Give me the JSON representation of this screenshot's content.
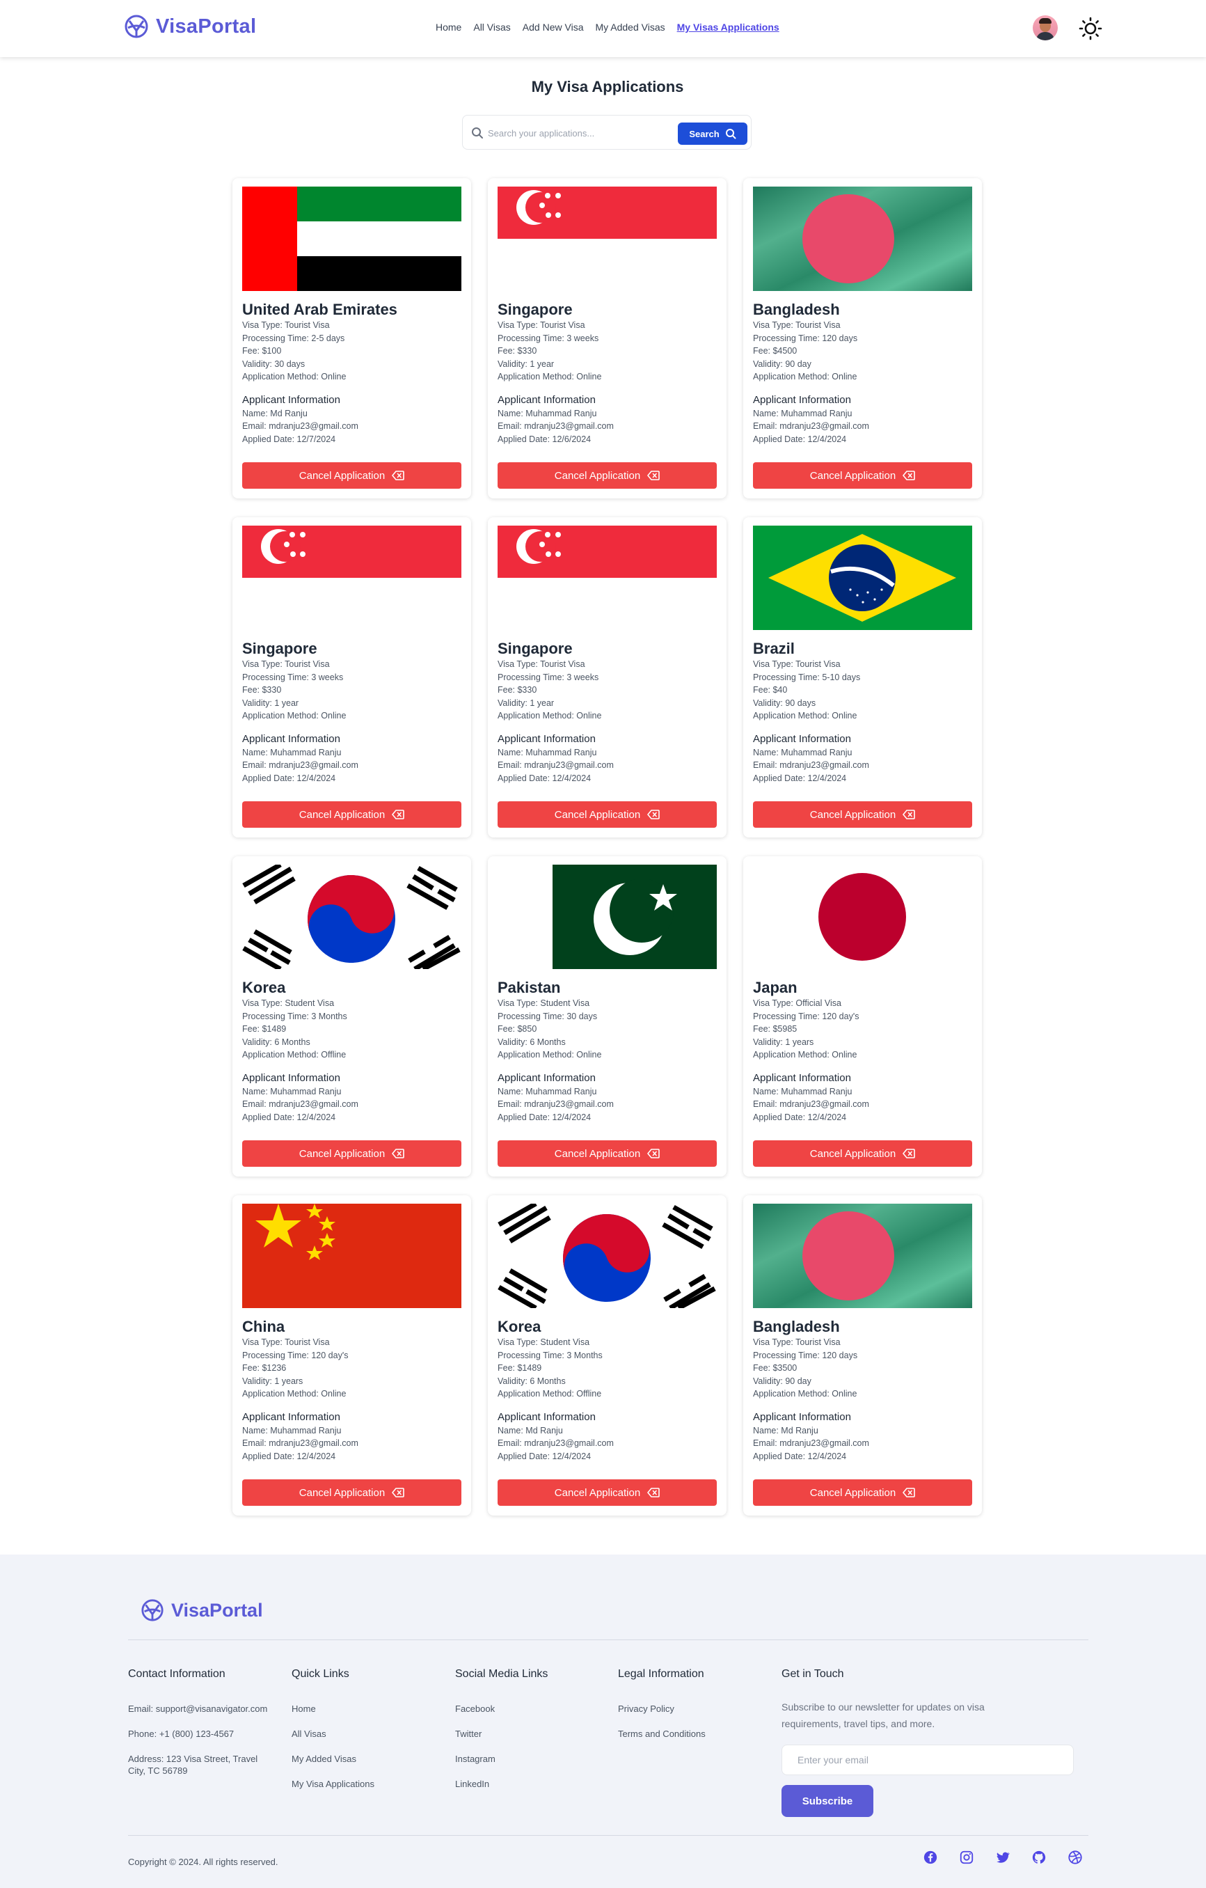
{
  "header": {
    "logo_text": "VisaPortal",
    "nav": [
      "Home",
      "All Visas",
      "Add New Visa",
      "My Added Visas",
      "My Visas Applications"
    ],
    "active_nav_index": 4
  },
  "main": {
    "title": "My Visa Applications",
    "search_placeholder": "Search your applications...",
    "search_button": "Search"
  },
  "labels": {
    "applicant_info": "Applicant Information",
    "cancel": "Cancel Application"
  },
  "applications": [
    {
      "flag": "uae",
      "country": "United Arab Emirates",
      "visa_type": "Visa Type: Tourist Visa",
      "processing": "Processing Time: 2-5 days",
      "fee": "Fee: $100",
      "validity": "Validity: 30 days",
      "method": "Application Method: Online",
      "name": "Name: Md Ranju",
      "email": "Email: mdranju23@gmail.com",
      "date": "Applied Date: 12/7/2024"
    },
    {
      "flag": "singapore",
      "country": "Singapore",
      "visa_type": "Visa Type: Tourist Visa",
      "processing": "Processing Time: 3 weeks",
      "fee": "Fee: $330",
      "validity": "Validity: 1 year",
      "method": "Application Method: Online",
      "name": "Name: Muhammad Ranju",
      "email": "Email: mdranju23@gmail.com",
      "date": "Applied Date: 12/6/2024"
    },
    {
      "flag": "bangladesh",
      "country": "Bangladesh",
      "visa_type": "Visa Type: Tourist Visa",
      "processing": "Processing Time: 120 days",
      "fee": "Fee: $4500",
      "validity": "Validity: 90 day",
      "method": "Application Method: Online",
      "name": "Name: Muhammad Ranju",
      "email": "Email: mdranju23@gmail.com",
      "date": "Applied Date: 12/4/2024"
    },
    {
      "flag": "singapore",
      "country": "Singapore",
      "visa_type": "Visa Type: Tourist Visa",
      "processing": "Processing Time: 3 weeks",
      "fee": "Fee: $330",
      "validity": "Validity: 1 year",
      "method": "Application Method: Online",
      "name": "Name: Muhammad Ranju",
      "email": "Email: mdranju23@gmail.com",
      "date": "Applied Date: 12/4/2024"
    },
    {
      "flag": "singapore",
      "country": "Singapore",
      "visa_type": "Visa Type: Tourist Visa",
      "processing": "Processing Time: 3 weeks",
      "fee": "Fee: $330",
      "validity": "Validity: 1 year",
      "method": "Application Method: Online",
      "name": "Name: Muhammad Ranju",
      "email": "Email: mdranju23@gmail.com",
      "date": "Applied Date: 12/4/2024"
    },
    {
      "flag": "brazil",
      "country": "Brazil",
      "visa_type": "Visa Type: Tourist Visa",
      "processing": "Processing Time: 5-10 days",
      "fee": "Fee: $40",
      "validity": "Validity: 90 days",
      "method": "Application Method: Online",
      "name": "Name: Muhammad Ranju",
      "email": "Email: mdranju23@gmail.com",
      "date": "Applied Date: 12/4/2024"
    },
    {
      "flag": "korea",
      "country": "Korea",
      "visa_type": "Visa Type: Student Visa",
      "processing": "Processing Time: 3 Months",
      "fee": "Fee: $1489",
      "validity": "Validity: 6 Months",
      "method": "Application Method: Offline",
      "name": "Name: Muhammad Ranju",
      "email": "Email: mdranju23@gmail.com",
      "date": "Applied Date: 12/4/2024"
    },
    {
      "flag": "pakistan",
      "country": "Pakistan",
      "visa_type": "Visa Type: Student Visa",
      "processing": "Processing Time: 30 days",
      "fee": "Fee: $850",
      "validity": "Validity: 6 Months",
      "method": "Application Method: Online",
      "name": "Name: Muhammad Ranju",
      "email": "Email: mdranju23@gmail.com",
      "date": "Applied Date: 12/4/2024"
    },
    {
      "flag": "japan",
      "country": "Japan",
      "visa_type": "Visa Type: Official Visa",
      "processing": "Processing Time: 120 day's",
      "fee": "Fee: $5985",
      "validity": "Validity: 1 years",
      "method": "Application Method: Online",
      "name": "Name: Muhammad Ranju",
      "email": "Email: mdranju23@gmail.com",
      "date": "Applied Date: 12/4/2024"
    },
    {
      "flag": "china",
      "country": "China",
      "visa_type": "Visa Type: Tourist Visa",
      "processing": "Processing Time: 120 day's",
      "fee": "Fee: $1236",
      "validity": "Validity: 1 years",
      "method": "Application Method: Online",
      "name": "Name: Muhammad Ranju",
      "email": "Email: mdranju23@gmail.com",
      "date": "Applied Date: 12/4/2024"
    },
    {
      "flag": "korea",
      "country": "Korea",
      "visa_type": "Visa Type: Student Visa",
      "processing": "Processing Time: 3 Months",
      "fee": "Fee: $1489",
      "validity": "Validity: 6 Months",
      "method": "Application Method: Offline",
      "name": "Name: Md Ranju",
      "email": "Email: mdranju23@gmail.com",
      "date": "Applied Date: 12/4/2024"
    },
    {
      "flag": "bangladesh",
      "country": "Bangladesh",
      "visa_type": "Visa Type: Tourist Visa",
      "processing": "Processing Time: 120 days",
      "fee": "Fee: $3500",
      "validity": "Validity: 90 day",
      "method": "Application Method: Online",
      "name": "Name: Md Ranju",
      "email": "Email: mdranju23@gmail.com",
      "date": "Applied Date: 12/4/2024"
    }
  ],
  "footer": {
    "logo_text": "VisaPortal",
    "contact": {
      "title": "Contact Information",
      "email": "Email: support@visanavigator.com",
      "phone": "Phone: +1 (800) 123-4567",
      "address": "Address: 123 Visa Street, Travel City, TC 56789"
    },
    "quick_links": {
      "title": "Quick Links",
      "items": [
        "Home",
        "All Visas",
        "My Added Visas",
        "My Visa Applications"
      ]
    },
    "social": {
      "title": "Social Media Links",
      "items": [
        "Facebook",
        "Twitter",
        "Instagram",
        "LinkedIn"
      ]
    },
    "legal": {
      "title": "Legal Information",
      "items": [
        "Privacy Policy",
        "Terms and Conditions"
      ]
    },
    "newsletter": {
      "title": "Get in Touch",
      "text": "Subscribe to our newsletter for updates on visa requirements, travel tips, and more.",
      "placeholder": "Enter your email",
      "button": "Subscribe"
    },
    "copyright": "Copyright © 2024. All rights reserved.",
    "social_icons": [
      "facebook-icon",
      "instagram-icon",
      "twitter-icon",
      "github-icon",
      "dribbble-icon"
    ]
  }
}
